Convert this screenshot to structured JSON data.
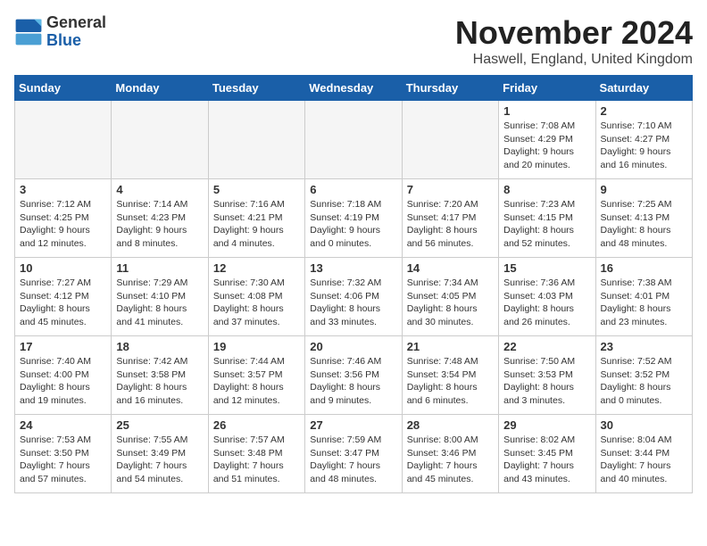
{
  "header": {
    "logo_general": "General",
    "logo_blue": "Blue",
    "month_title": "November 2024",
    "location": "Haswell, England, United Kingdom"
  },
  "days_of_week": [
    "Sunday",
    "Monday",
    "Tuesday",
    "Wednesday",
    "Thursday",
    "Friday",
    "Saturday"
  ],
  "cells": [
    {
      "day": "",
      "content": ""
    },
    {
      "day": "",
      "content": ""
    },
    {
      "day": "",
      "content": ""
    },
    {
      "day": "",
      "content": ""
    },
    {
      "day": "",
      "content": ""
    },
    {
      "day": "1",
      "content": "Sunrise: 7:08 AM\nSunset: 4:29 PM\nDaylight: 9 hours\nand 20 minutes."
    },
    {
      "day": "2",
      "content": "Sunrise: 7:10 AM\nSunset: 4:27 PM\nDaylight: 9 hours\nand 16 minutes."
    },
    {
      "day": "3",
      "content": "Sunrise: 7:12 AM\nSunset: 4:25 PM\nDaylight: 9 hours\nand 12 minutes."
    },
    {
      "day": "4",
      "content": "Sunrise: 7:14 AM\nSunset: 4:23 PM\nDaylight: 9 hours\nand 8 minutes."
    },
    {
      "day": "5",
      "content": "Sunrise: 7:16 AM\nSunset: 4:21 PM\nDaylight: 9 hours\nand 4 minutes."
    },
    {
      "day": "6",
      "content": "Sunrise: 7:18 AM\nSunset: 4:19 PM\nDaylight: 9 hours\nand 0 minutes."
    },
    {
      "day": "7",
      "content": "Sunrise: 7:20 AM\nSunset: 4:17 PM\nDaylight: 8 hours\nand 56 minutes."
    },
    {
      "day": "8",
      "content": "Sunrise: 7:23 AM\nSunset: 4:15 PM\nDaylight: 8 hours\nand 52 minutes."
    },
    {
      "day": "9",
      "content": "Sunrise: 7:25 AM\nSunset: 4:13 PM\nDaylight: 8 hours\nand 48 minutes."
    },
    {
      "day": "10",
      "content": "Sunrise: 7:27 AM\nSunset: 4:12 PM\nDaylight: 8 hours\nand 45 minutes."
    },
    {
      "day": "11",
      "content": "Sunrise: 7:29 AM\nSunset: 4:10 PM\nDaylight: 8 hours\nand 41 minutes."
    },
    {
      "day": "12",
      "content": "Sunrise: 7:30 AM\nSunset: 4:08 PM\nDaylight: 8 hours\nand 37 minutes."
    },
    {
      "day": "13",
      "content": "Sunrise: 7:32 AM\nSunset: 4:06 PM\nDaylight: 8 hours\nand 33 minutes."
    },
    {
      "day": "14",
      "content": "Sunrise: 7:34 AM\nSunset: 4:05 PM\nDaylight: 8 hours\nand 30 minutes."
    },
    {
      "day": "15",
      "content": "Sunrise: 7:36 AM\nSunset: 4:03 PM\nDaylight: 8 hours\nand 26 minutes."
    },
    {
      "day": "16",
      "content": "Sunrise: 7:38 AM\nSunset: 4:01 PM\nDaylight: 8 hours\nand 23 minutes."
    },
    {
      "day": "17",
      "content": "Sunrise: 7:40 AM\nSunset: 4:00 PM\nDaylight: 8 hours\nand 19 minutes."
    },
    {
      "day": "18",
      "content": "Sunrise: 7:42 AM\nSunset: 3:58 PM\nDaylight: 8 hours\nand 16 minutes."
    },
    {
      "day": "19",
      "content": "Sunrise: 7:44 AM\nSunset: 3:57 PM\nDaylight: 8 hours\nand 12 minutes."
    },
    {
      "day": "20",
      "content": "Sunrise: 7:46 AM\nSunset: 3:56 PM\nDaylight: 8 hours\nand 9 minutes."
    },
    {
      "day": "21",
      "content": "Sunrise: 7:48 AM\nSunset: 3:54 PM\nDaylight: 8 hours\nand 6 minutes."
    },
    {
      "day": "22",
      "content": "Sunrise: 7:50 AM\nSunset: 3:53 PM\nDaylight: 8 hours\nand 3 minutes."
    },
    {
      "day": "23",
      "content": "Sunrise: 7:52 AM\nSunset: 3:52 PM\nDaylight: 8 hours\nand 0 minutes."
    },
    {
      "day": "24",
      "content": "Sunrise: 7:53 AM\nSunset: 3:50 PM\nDaylight: 7 hours\nand 57 minutes."
    },
    {
      "day": "25",
      "content": "Sunrise: 7:55 AM\nSunset: 3:49 PM\nDaylight: 7 hours\nand 54 minutes."
    },
    {
      "day": "26",
      "content": "Sunrise: 7:57 AM\nSunset: 3:48 PM\nDaylight: 7 hours\nand 51 minutes."
    },
    {
      "day": "27",
      "content": "Sunrise: 7:59 AM\nSunset: 3:47 PM\nDaylight: 7 hours\nand 48 minutes."
    },
    {
      "day": "28",
      "content": "Sunrise: 8:00 AM\nSunset: 3:46 PM\nDaylight: 7 hours\nand 45 minutes."
    },
    {
      "day": "29",
      "content": "Sunrise: 8:02 AM\nSunset: 3:45 PM\nDaylight: 7 hours\nand 43 minutes."
    },
    {
      "day": "30",
      "content": "Sunrise: 8:04 AM\nSunset: 3:44 PM\nDaylight: 7 hours\nand 40 minutes."
    }
  ]
}
